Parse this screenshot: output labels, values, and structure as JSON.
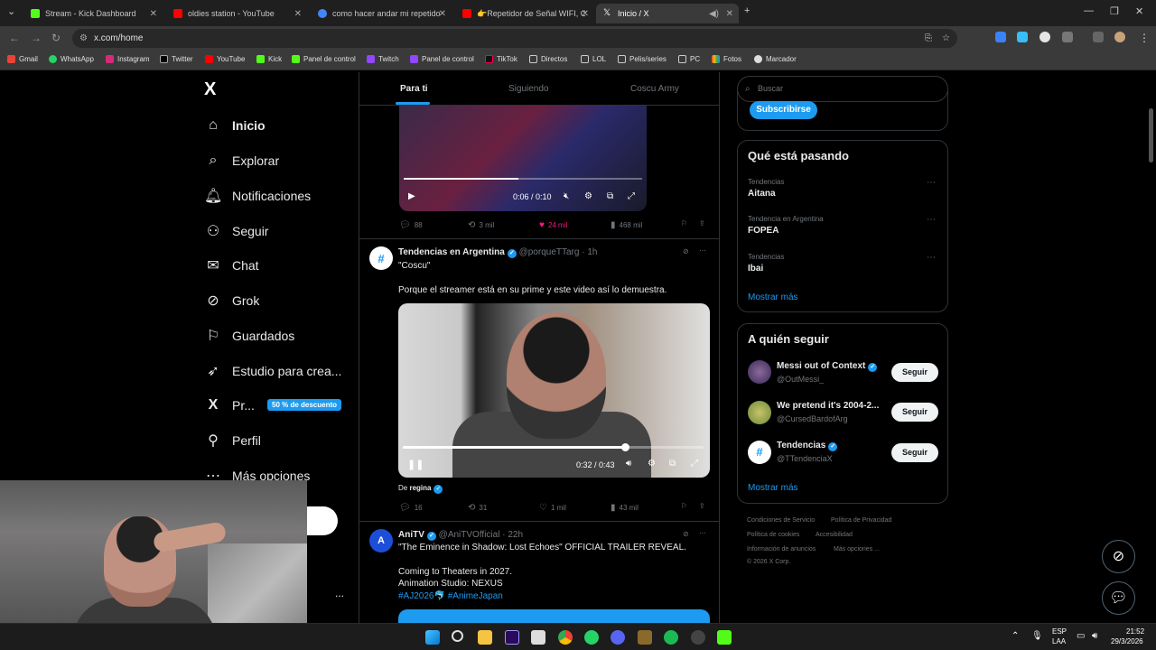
{
  "browser": {
    "tabs": [
      {
        "label": "Stream - Kick Dashboard",
        "color": "#53fc18"
      },
      {
        "label": "oldies station - YouTube",
        "color": "#ff0000"
      },
      {
        "label": "como hacer andar mi repetidor",
        "color": "#4285f4"
      },
      {
        "label": "👉Repetidor de Señal WIFI, Co",
        "color": "#ff0000"
      },
      {
        "label": "Inicio / X",
        "color": "#ffffff"
      }
    ],
    "new_tab": "+",
    "url": "x.com/home",
    "bookmarks": [
      "Gmail",
      "WhatsApp",
      "Instagram",
      "Twitter",
      "YouTube",
      "Kick",
      "Panel de control",
      "Twitch",
      "Panel de control",
      "TikTok",
      "Directos",
      "LOL",
      "Pelis/series",
      "PC",
      "Fotos",
      "Marcador"
    ]
  },
  "nav": {
    "logo": "X",
    "items": [
      {
        "label": "Inicio",
        "icon": "⌂"
      },
      {
        "label": "Explorar",
        "icon": "⌕"
      },
      {
        "label": "Notificaciones",
        "icon": "🔔︎"
      },
      {
        "label": "Seguir",
        "icon": "⚇"
      },
      {
        "label": "Chat",
        "icon": "✉"
      },
      {
        "label": "Grok",
        "icon": "⊘"
      },
      {
        "label": "Guardados",
        "icon": "⚐"
      },
      {
        "label": "Estudio para crea...",
        "icon": "➶"
      },
      {
        "label": "Pr...",
        "icon": "X"
      },
      {
        "label": "Perfil",
        "icon": "⚲"
      },
      {
        "label": "Más opciones",
        "icon": "⋯"
      }
    ],
    "promo_badge": "50 % de descuento",
    "more_dots": "..."
  },
  "feed": {
    "tabs": [
      "Para ti",
      "Siguiendo",
      "Coscu Army"
    ],
    "post1": {
      "time": "0:06 / 0:10",
      "progress": 0.48,
      "replies": "88",
      "reposts": "3 mil",
      "likes": "24 mil",
      "views": "468 mil"
    },
    "post2": {
      "author": "Tendencias en Argentina",
      "handle": "@porqueTTarg",
      "age": "· 1h",
      "quote": "\"Coscu\"",
      "body": "Porque el streamer está en su prime y este video así lo demuestra.",
      "time": "0:32 / 0:43",
      "progress": 0.74,
      "credit_prefix": "De",
      "credit_user": "regina",
      "replies": "16",
      "reposts": "31",
      "likes": "1 mil",
      "views": "43 mil"
    },
    "post3": {
      "author": "AniTV",
      "handle": "@AniTVOfficial",
      "age": "· 22h",
      "line1": "\"The Eminence in Shadow: Lost Echoes\" OFFICIAL TRAILER REVEAL.",
      "line2": "Coming to Theaters in 2027.",
      "line3": "Animation Studio: NEXUS",
      "tags": "#AJ2026🐬 #AnimeJapan"
    }
  },
  "sidebar": {
    "search_placeholder": "Buscar",
    "subscribe": "Subscribirse",
    "trends_title": "Qué está pasando",
    "trends": [
      {
        "meta": "Tendencias",
        "name": "Aitana"
      },
      {
        "meta": "Tendencia en Argentina",
        "name": "FOPEA"
      },
      {
        "meta": "Tendencias",
        "name": "Ibai"
      }
    ],
    "show_more": "Mostrar más",
    "follow_title": "A quién seguir",
    "follow": [
      {
        "name": "Messi out of Context",
        "handle": "@OutMessi_",
        "button": "Seguir"
      },
      {
        "name": "We pretend it's 2004-2...",
        "handle": "@CursedBardofArg",
        "button": "Seguir"
      },
      {
        "name": "Tendencias",
        "handle": "@TTendenciaX",
        "button": "Seguir"
      }
    ],
    "show_more2": "Mostrar más",
    "footer": {
      "l1a": "Condiciones de Servicio",
      "l1b": "Política de Privacidad",
      "l2a": "Política de cookies",
      "l2b": "Accesibilidad",
      "l3a": "Información de anuncios",
      "l3b": "Más opciones ...",
      "l4": "© 2026 X Corp."
    }
  },
  "taskbar": {
    "lang1": "ESP",
    "lang2": "LAA",
    "time": "21:52",
    "date": "29/3/2026"
  }
}
